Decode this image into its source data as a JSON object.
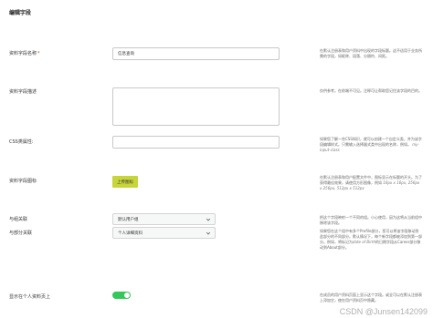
{
  "page": {
    "title": "编辑字段"
  },
  "fields": {
    "name": {
      "label": "资料字段名称",
      "required_mark": "*",
      "value": "信息查询",
      "desc": "在默认注册表和用户资料中出现的字段标题。这不适用于业务所需的字段，如昵称、段落、分隔符、间距。"
    },
    "description": {
      "label": "资料字段描述",
      "value": "",
      "desc": "仅供参考。在前端不可见。注释可让帮助您记住该字段的目的。"
    },
    "css": {
      "label": "CSS类属性:",
      "value": "",
      "desc_parts": [
        "如果您了解一些CSS知识，就可以创建一个自定义类，并为该字段编辑样式。只需输入选择器式类中出现的名称，例如。",
        "my-input-class"
      ]
    },
    "icon": {
      "label": "资料字段图标",
      "button": "上传图标",
      "desc": "在默认注册表和用户配置文件中，图标显示在标题的开头。为了获得最佳效果，请使用方形图像，例如 ",
      "sizes": "16px x 16px, 256px x 256px, 512px x 512px"
    },
    "group": {
      "label": "与组关联",
      "value": "默认用户组",
      "desc": "把这个字段映射一个不同的组。小心使用，因为这将从当前组中移除该字段。"
    },
    "section": {
      "label": "与部分关联",
      "value": "个人详细资料",
      "desc_parts": [
        "如果您在这个组中有多个Profile部分，您可以将该字段移动到此部分的不同部分。默认情况下，每个新字段都被添加到第一部分。例如，将标记为",
        "date of Birth",
        "的日期字段从Career部分移动到About部分。"
      ]
    },
    "public": {
      "label": "显示在个人资料页上",
      "enabled": "true",
      "desc": "在成员的用户资料页面上显示这个字段。或全可以在默认注册表上添加它，使在用户资料页中隐藏。"
    }
  },
  "watermark": "CSDN @Junsen142099",
  "colors": {
    "accent_button": "#c7d43a",
    "toggle_on": "#34c759",
    "required": "#d63638"
  }
}
